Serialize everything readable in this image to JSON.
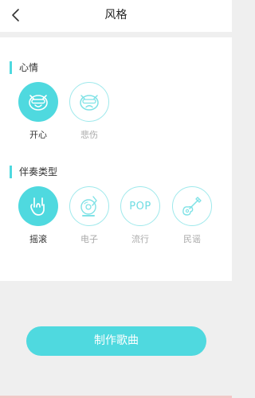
{
  "header": {
    "title": "风格",
    "back_icon": "chevron-left-icon"
  },
  "mood": {
    "label": "心情",
    "options": [
      {
        "label": "开心",
        "icon": "happy-cat-face-icon",
        "selected": true
      },
      {
        "label": "悲伤",
        "icon": "sad-cat-face-icon",
        "selected": false
      }
    ]
  },
  "accompaniment": {
    "label": "伴奏类型",
    "options": [
      {
        "label": "摇滚",
        "icon": "rock-hand-icon",
        "selected": true
      },
      {
        "label": "电子",
        "icon": "vinyl-record-icon",
        "selected": false
      },
      {
        "label": "流行",
        "icon_text": "POP",
        "icon": "pop-text-icon",
        "selected": false
      },
      {
        "label": "民谣",
        "icon": "guitar-icon",
        "selected": false
      }
    ]
  },
  "action": {
    "make_song_label": "制作歌曲"
  },
  "colors": {
    "accent": "#4fd9df",
    "accent_light": "#9fe9ec",
    "background": "#efefef",
    "unselected_text": "#aaaaaa"
  }
}
